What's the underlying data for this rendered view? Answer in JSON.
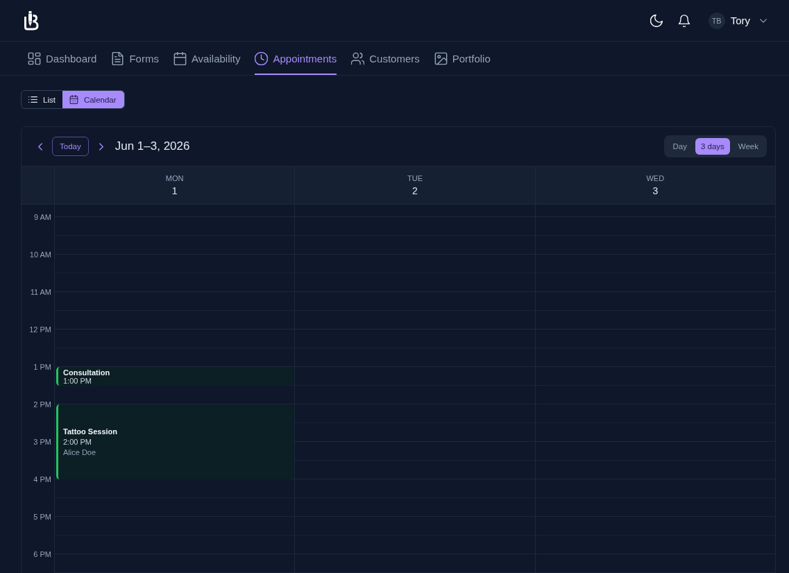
{
  "header": {
    "user": {
      "initials": "TB",
      "name": "Tory"
    }
  },
  "nav": {
    "items": [
      {
        "label": "Dashboard",
        "selected": false
      },
      {
        "label": "Forms",
        "selected": false
      },
      {
        "label": "Availability",
        "selected": false
      },
      {
        "label": "Appointments",
        "selected": true
      },
      {
        "label": "Customers",
        "selected": false
      },
      {
        "label": "Portfolio",
        "selected": false
      }
    ]
  },
  "view_toggle": [
    {
      "label": "List",
      "selected": false
    },
    {
      "label": "Calendar",
      "selected": true
    }
  ],
  "calendar": {
    "today_button": "Today",
    "title": "Jun 1–3, 2026",
    "ranges": [
      {
        "label": "Day",
        "selected": false
      },
      {
        "label": "3 days",
        "selected": true
      },
      {
        "label": "Week",
        "selected": false
      }
    ],
    "days": [
      {
        "weekday": "MON",
        "date": "1",
        "events": [
          {
            "kind": "short",
            "title": "Consultation",
            "time": "1:00 PM"
          },
          {
            "kind": "long",
            "title": "Tattoo Session",
            "time": "2:00 PM",
            "customer": "Alice Doe"
          }
        ]
      },
      {
        "weekday": "TUE",
        "date": "2"
      },
      {
        "weekday": "WED",
        "date": "3"
      }
    ],
    "hours": [
      "9 AM",
      "10 AM",
      "11 AM",
      "12 PM",
      "1 PM",
      "2 PM",
      "3 PM",
      "4 PM",
      "5 PM",
      "6 PM"
    ]
  }
}
